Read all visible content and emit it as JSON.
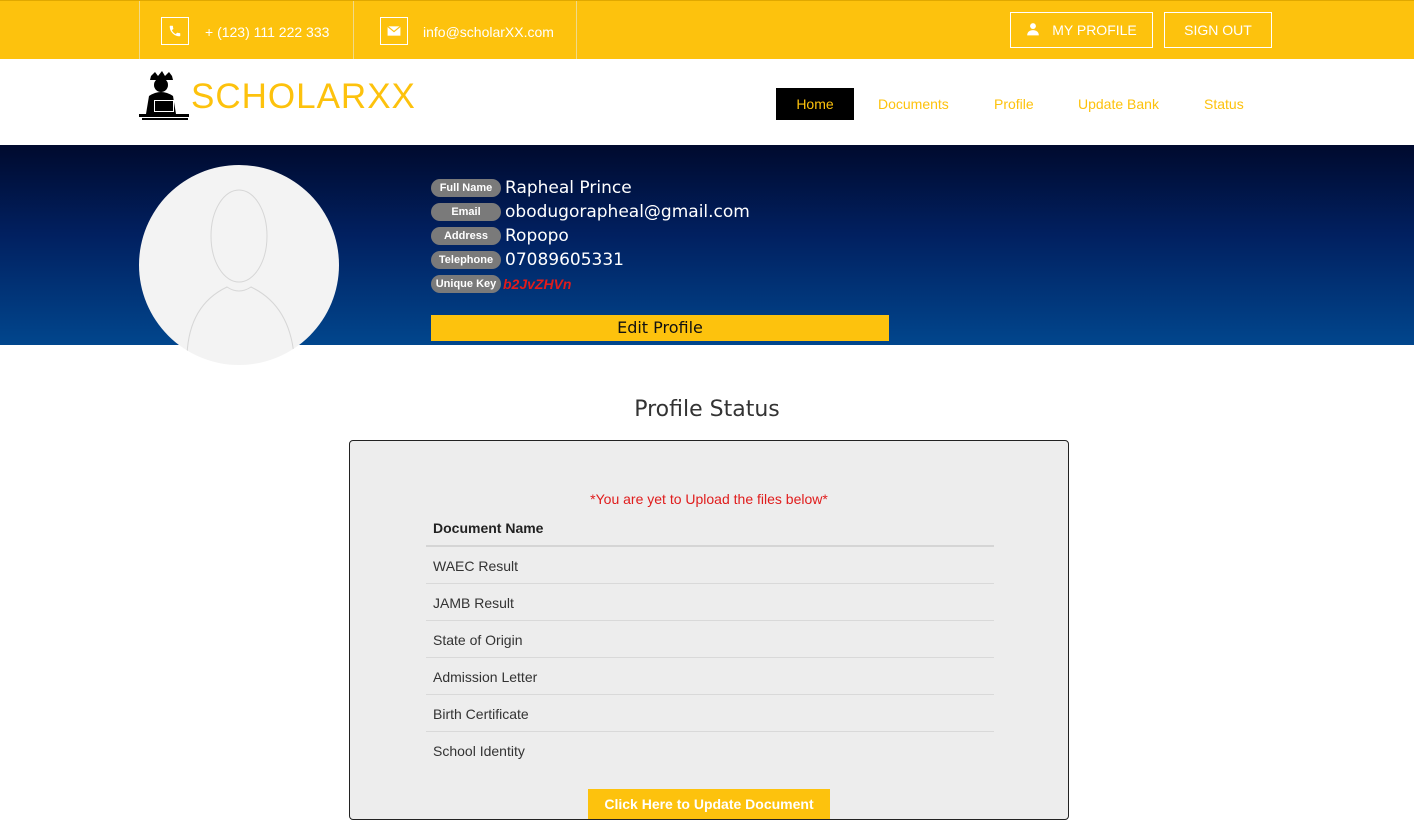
{
  "topbar": {
    "phone": "+ (123) 111 222 333",
    "email": "info@scholarXX.com",
    "my_profile_label": "MY PROFILE",
    "sign_out_label": "SIGN OUT"
  },
  "brand": {
    "name": "SCHOLARXX"
  },
  "nav": {
    "items": [
      {
        "label": "Home"
      },
      {
        "label": "Documents"
      },
      {
        "label": "Profile"
      },
      {
        "label": "Update Bank"
      },
      {
        "label": "Status"
      }
    ]
  },
  "profile": {
    "fields": [
      {
        "label": "Full Name",
        "value": "Rapheal Prince"
      },
      {
        "label": "Email",
        "value": "obodugorapheal@gmail.com"
      },
      {
        "label": "Address",
        "value": "Ropopo"
      },
      {
        "label": "Telephone",
        "value": "07089605331"
      },
      {
        "label": "Unique Key",
        "value": "b2JvZHVn"
      }
    ],
    "edit_label": "Edit Profile"
  },
  "status": {
    "title": "Profile Status",
    "warning": "*You are yet to Upload the files below*",
    "column_header": "Document Name",
    "documents": [
      "WAEC Result",
      "JAMB Result",
      "State of Origin",
      "Admission Letter",
      "Birth Certificate",
      "School Identity"
    ],
    "upload_label": "Click Here to Update Document"
  },
  "colors": {
    "accent": "#fdc20d",
    "hero_dark": "#000a2e",
    "hero_light": "#01468d",
    "warning": "#e01c1c"
  }
}
